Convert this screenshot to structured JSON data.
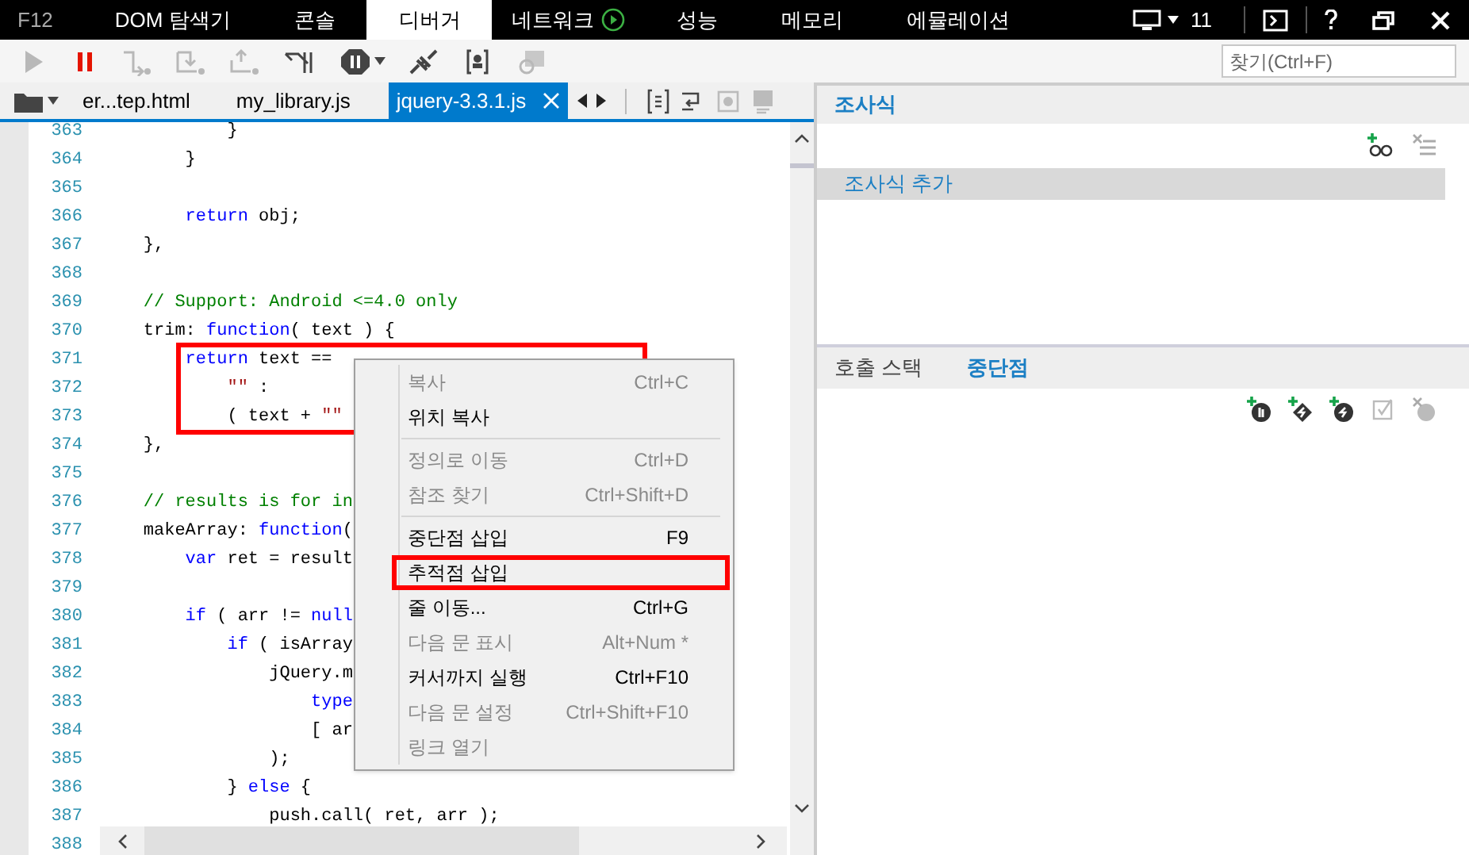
{
  "main_tabs": [
    {
      "label": "F12",
      "kind": "label",
      "selected": false
    },
    {
      "label": "DOM 탐색기",
      "kind": "tab",
      "selected": false
    },
    {
      "label": "콘솔",
      "kind": "tab",
      "selected": false
    },
    {
      "label": "디버거",
      "kind": "tab",
      "selected": true
    },
    {
      "label": "네트워크",
      "kind": "tab-play",
      "selected": false
    },
    {
      "label": "성능",
      "kind": "tab",
      "selected": false
    },
    {
      "label": "메모리",
      "kind": "tab",
      "selected": false
    },
    {
      "label": "에뮬레이션",
      "kind": "tab",
      "selected": false
    }
  ],
  "target_count": "11",
  "search": {
    "placeholder": "찾기(Ctrl+F)"
  },
  "file_tabs": [
    {
      "label": "er...tep.html",
      "selected": false
    },
    {
      "label": "my_library.js",
      "selected": false
    },
    {
      "label": "jquery-3.3.1.js",
      "selected": true
    }
  ],
  "code_lines": [
    {
      "number": "363",
      "outlined": false,
      "tokens": [
        {
          "kind": "plain",
          "text": "            }"
        }
      ]
    },
    {
      "number": "364",
      "outlined": false,
      "tokens": [
        {
          "kind": "plain",
          "text": "        }"
        }
      ]
    },
    {
      "number": "365",
      "outlined": false
    },
    {
      "number": "366",
      "outlined": false,
      "tokens": [
        {
          "kind": "keyword",
          "text": "        return"
        },
        {
          "kind": "plain",
          "text": " obj;"
        }
      ]
    },
    {
      "number": "367",
      "outlined": false,
      "tokens": [
        {
          "kind": "plain",
          "text": "    },"
        }
      ]
    },
    {
      "number": "368",
      "outlined": false
    },
    {
      "number": "369",
      "outlined": false,
      "tokens": [
        {
          "kind": "comment",
          "text": "    // Support: Android <=4.0 only"
        }
      ]
    },
    {
      "number": "370",
      "outlined": false,
      "tokens": [
        {
          "kind": "plain",
          "text": "    trim: "
        },
        {
          "kind": "keyword",
          "text": "function"
        },
        {
          "kind": "plain",
          "text": "( text ) {"
        }
      ]
    },
    {
      "number": "371",
      "outlined": true,
      "tokens": [
        {
          "kind": "keyword",
          "text": "        return"
        },
        {
          "kind": "plain",
          "text": " text =="
        }
      ]
    },
    {
      "number": "372",
      "outlined": true,
      "tokens": [
        {
          "kind": "string",
          "text": "            \"\""
        },
        {
          "kind": "plain",
          "text": " :"
        }
      ]
    },
    {
      "number": "373",
      "outlined": true,
      "tokens": [
        {
          "kind": "plain",
          "text": "            ( text + "
        },
        {
          "kind": "string",
          "text": "\"\""
        }
      ]
    },
    {
      "number": "374",
      "outlined": false,
      "tokens": [
        {
          "kind": "plain",
          "text": "    },"
        }
      ]
    },
    {
      "number": "375",
      "outlined": false
    },
    {
      "number": "376",
      "outlined": false,
      "tokens": [
        {
          "kind": "comment",
          "text": "    // results is for in"
        }
      ]
    },
    {
      "number": "377",
      "outlined": false,
      "tokens": [
        {
          "kind": "plain",
          "text": "    makeArray: "
        },
        {
          "kind": "keyword",
          "text": "function"
        },
        {
          "kind": "plain",
          "text": "("
        }
      ]
    },
    {
      "number": "378",
      "outlined": false,
      "tokens": [
        {
          "kind": "keyword",
          "text": "        var"
        },
        {
          "kind": "plain",
          "text": " ret = result"
        }
      ]
    },
    {
      "number": "379",
      "outlined": false
    },
    {
      "number": "380",
      "outlined": false,
      "tokens": [
        {
          "kind": "keyword",
          "text": "        if"
        },
        {
          "kind": "plain",
          "text": " ( arr != "
        },
        {
          "kind": "keyword",
          "text": "null"
        }
      ]
    },
    {
      "number": "381",
      "outlined": false,
      "tokens": [
        {
          "kind": "keyword",
          "text": "            if"
        },
        {
          "kind": "plain",
          "text": " ( isArray"
        }
      ]
    },
    {
      "number": "382",
      "outlined": false,
      "tokens": [
        {
          "kind": "plain",
          "text": "                jQuery.m"
        }
      ]
    },
    {
      "number": "383",
      "outlined": false,
      "tokens": [
        {
          "kind": "keyword",
          "text": "                    type"
        }
      ]
    },
    {
      "number": "384",
      "outlined": false,
      "tokens": [
        {
          "kind": "plain",
          "text": "                    [ ar"
        }
      ]
    },
    {
      "number": "385",
      "outlined": false,
      "tokens": [
        {
          "kind": "plain",
          "text": "                );"
        }
      ]
    },
    {
      "number": "386",
      "outlined": false,
      "tokens": [
        {
          "kind": "plain",
          "text": "            } "
        },
        {
          "kind": "keyword",
          "text": "else"
        },
        {
          "kind": "plain",
          "text": " {"
        }
      ]
    },
    {
      "number": "387",
      "outlined": false,
      "tokens": [
        {
          "kind": "plain",
          "text": "                push.call( ret, arr );"
        }
      ]
    },
    {
      "number": "388",
      "outlined": false
    }
  ],
  "context_menu": [
    {
      "kind": "item",
      "label": "복사",
      "shortcut": "Ctrl+C",
      "disabled": true,
      "outlined": false
    },
    {
      "kind": "item",
      "label": "위치 복사",
      "disabled": false,
      "outlined": false
    },
    {
      "kind": "separator"
    },
    {
      "kind": "item",
      "label": "정의로 이동",
      "shortcut": "Ctrl+D",
      "disabled": true,
      "outlined": false
    },
    {
      "kind": "item",
      "label": "참조 찾기",
      "shortcut": "Ctrl+Shift+D",
      "disabled": true,
      "outlined": false
    },
    {
      "kind": "separator"
    },
    {
      "kind": "item",
      "label": "중단점 삽입",
      "shortcut": "F9",
      "disabled": false,
      "outlined": false
    },
    {
      "kind": "item",
      "label": "추적점 삽입",
      "disabled": false,
      "outlined": true
    },
    {
      "kind": "item",
      "label": "줄 이동...",
      "shortcut": "Ctrl+G",
      "disabled": false,
      "outlined": false
    },
    {
      "kind": "item",
      "label": "다음 문 표시",
      "shortcut": "Alt+Num *",
      "disabled": true,
      "outlined": false
    },
    {
      "kind": "item",
      "label": "커서까지 실행",
      "shortcut": "Ctrl+F10",
      "disabled": false,
      "outlined": false
    },
    {
      "kind": "item",
      "label": "다음 문 설정",
      "shortcut": "Ctrl+Shift+F10",
      "disabled": true,
      "outlined": false
    },
    {
      "kind": "item",
      "label": "링크 열기",
      "disabled": true,
      "outlined": false
    }
  ],
  "watch": {
    "title": "조사식",
    "add_entry": "조사식 추가"
  },
  "lower_tabs": [
    {
      "label": "호출 스택",
      "selected": false
    },
    {
      "label": "중단점",
      "selected": true
    }
  ]
}
